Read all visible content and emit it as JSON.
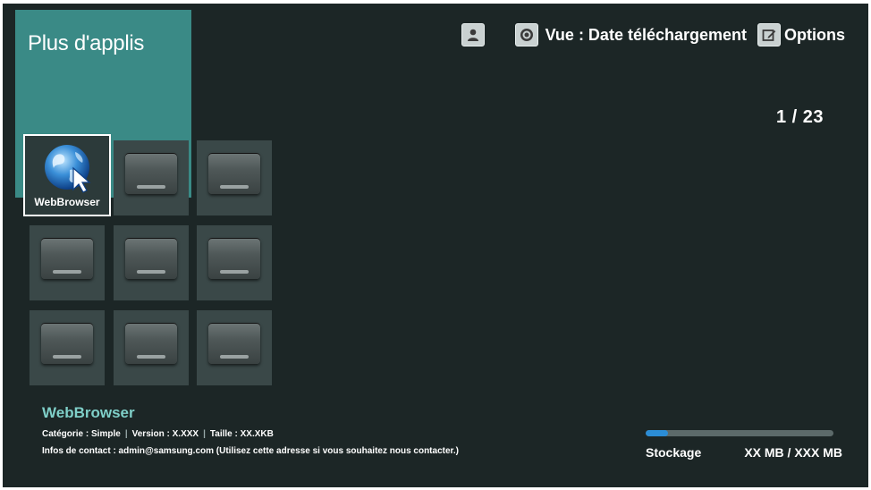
{
  "header": {
    "title": "Plus d'applis"
  },
  "topbar": {
    "profile_icon": "person-icon",
    "view_icon": "disc-icon",
    "view_label": "Vue : Date téléchargement",
    "options_icon": "edit-icon",
    "options_label": "Options"
  },
  "pager": {
    "indicator": "1 / 23"
  },
  "grid": {
    "apps": [
      {
        "label": "WebBrowser",
        "icon": "globe-cursor-icon",
        "focused": true
      },
      {
        "label": "",
        "empty": true
      },
      {
        "label": "",
        "empty": true
      },
      {
        "label": "",
        "empty": true
      },
      {
        "label": "",
        "empty": true
      },
      {
        "label": "",
        "empty": true
      },
      {
        "label": "",
        "empty": true
      },
      {
        "label": "",
        "empty": true
      },
      {
        "label": "",
        "empty": true
      }
    ]
  },
  "info": {
    "name": "WebBrowser",
    "category": "Catégorie : Simple",
    "version": "Version : X.XXX",
    "size": "Taille : XX.XKB",
    "contact": "Infos de contact : admin@samsung.com (Utilisez cette adresse si vous souhaitez nous contacter.)"
  },
  "storage": {
    "label": "Stockage",
    "value": "XX MB / XXX  MB",
    "used_fraction": 0.12
  },
  "colors": {
    "background": "#1c2626",
    "accent_panel": "#3a8a86",
    "info_name": "#7fcfc8",
    "storage_fill": "#2b8dd6"
  }
}
